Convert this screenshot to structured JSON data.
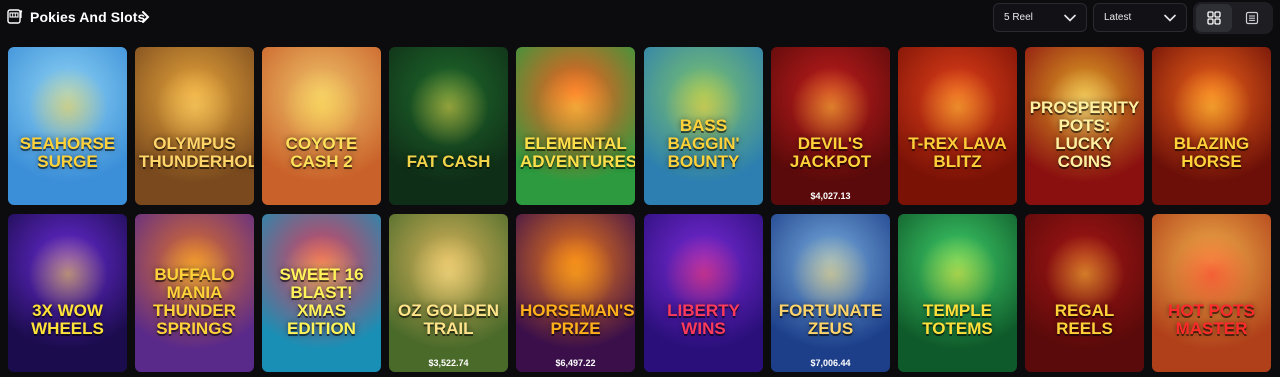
{
  "header": {
    "title": "Pokies And Slots",
    "reel_filter": "5 Reel",
    "sort_filter": "Latest"
  },
  "games": [
    {
      "name": "Seahorse Surge",
      "jackpot": "",
      "bg": "#3b8fd8",
      "bg2": "#8fd3f5",
      "accent": "#ffd23a"
    },
    {
      "name": "Olympus Thunderhold",
      "jackpot": "",
      "bg": "#7a4a1e",
      "bg2": "#e9a63b",
      "accent": "#ffd56a"
    },
    {
      "name": "Coyote Cash 2",
      "jackpot": "",
      "bg": "#c9612a",
      "bg2": "#f0c46a",
      "accent": "#ffe15a"
    },
    {
      "name": "Fat Cash",
      "jackpot": "",
      "bg": "#0f2e17",
      "bg2": "#1f6b2c",
      "accent": "#f2d44a"
    },
    {
      "name": "Elemental Adventures",
      "jackpot": "",
      "bg": "#2d9a3f",
      "bg2": "#ff5a1e",
      "accent": "#ffe04a"
    },
    {
      "name": "Bass Baggin' Bounty",
      "jackpot": "",
      "bg": "#2c7fb0",
      "bg2": "#7ec46a",
      "accent": "#ffd23a"
    },
    {
      "name": "Devil's Jackpot",
      "jackpot": "$4,027.13",
      "bg": "#5a0a0a",
      "bg2": "#c21d1d",
      "accent": "#ffd23a"
    },
    {
      "name": "T-Rex Lava Blitz",
      "jackpot": "",
      "bg": "#7a1206",
      "bg2": "#e3401a",
      "accent": "#ffcf3a"
    },
    {
      "name": "Prosperity Pots: Lucky Coins",
      "jackpot": "",
      "bg": "#8a1010",
      "bg2": "#e0a324",
      "accent": "#fff0a0"
    },
    {
      "name": "Blazing Horse",
      "jackpot": "",
      "bg": "#6b0f08",
      "bg2": "#f0631a",
      "accent": "#ffd23a"
    },
    {
      "name": "3x Wow Wheels",
      "jackpot": "",
      "bg": "#1b0c4d",
      "bg2": "#6a2bd9",
      "accent": "#ffe23a"
    },
    {
      "name": "Buffalo Mania Thunder Springs",
      "jackpot": "",
      "bg": "#5a2a8a",
      "bg2": "#e0722a",
      "accent": "#ffd23a"
    },
    {
      "name": "Sweet 16 Blast! Xmas Edition",
      "jackpot": "",
      "bg": "#1a8fb5",
      "bg2": "#e23b5a",
      "accent": "#fff35a"
    },
    {
      "name": "Oz Golden Trail",
      "jackpot": "$3,522.74",
      "bg": "#4a6a2a",
      "bg2": "#d6b35a",
      "accent": "#ffe48a"
    },
    {
      "name": "Horseman's Prize",
      "jackpot": "$6,497.22",
      "bg": "#3a0f4a",
      "bg2": "#f07a1a",
      "accent": "#ffb01a"
    },
    {
      "name": "Liberty Wins",
      "jackpot": "",
      "bg": "#2a0f7a",
      "bg2": "#7a2bd9",
      "accent": "#ff3a5a"
    },
    {
      "name": "Fortunate Zeus",
      "jackpot": "$7,006.44",
      "bg": "#1d3f8a",
      "bg2": "#7ab0e0",
      "accent": "#ffd56a"
    },
    {
      "name": "Temple Totems",
      "jackpot": "",
      "bg": "#0f5a2a",
      "bg2": "#3fd06a",
      "accent": "#ffe03a"
    },
    {
      "name": "Regal Reels",
      "jackpot": "",
      "bg": "#5a0a0a",
      "bg2": "#a51515",
      "accent": "#ffd23a"
    },
    {
      "name": "Hot Pots Master",
      "jackpot": "",
      "bg": "#b0401a",
      "bg2": "#f0b04a",
      "accent": "#ff2a2a"
    }
  ]
}
